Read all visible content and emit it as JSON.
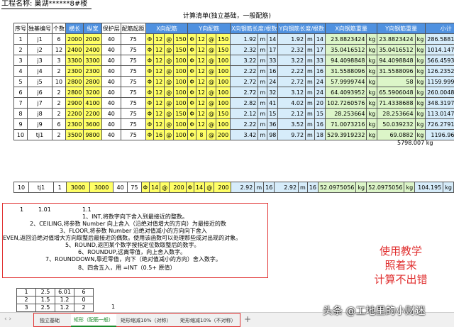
{
  "project_title": "工程名称: 巢湖******8#楼",
  "calc_title": "计算清单(独立基础，一般配筋)",
  "headers": [
    "序号",
    "独基编号",
    "个数",
    "横长",
    "纵宽",
    "保护层",
    "配筋起距",
    "X向配筋",
    "Y向配筋",
    "X向钢筋长度/根数",
    "Y向钢筋长度/根数",
    "X向钢筋重量",
    "Y向钢筋重量",
    "小计"
  ],
  "rows": [
    {
      "no": "1",
      "id": "j1",
      "count": "6",
      "len": "2000",
      "wid": "2000",
      "cover": "40",
      "start": "75",
      "x_phi": "Φ",
      "x_d": "12",
      "x_at": "@",
      "x_s": "150",
      "y_phi": "Φ",
      "y_d": "12",
      "y_at": "@",
      "y_s": "150",
      "xl": "1.92",
      "xu": "m",
      "xn": "14",
      "yl": "1.92",
      "yu": "m",
      "yn": "14",
      "xw": "23.8823424",
      "xwu": "kg",
      "yw": "23.8823424",
      "ywu": "kg",
      "sub": "286.5881",
      "subu": "kg"
    },
    {
      "no": "2",
      "id": "j2",
      "count": "12",
      "len": "2400",
      "wid": "2400",
      "cover": "40",
      "start": "75",
      "x_phi": "Φ",
      "x_d": "12",
      "x_at": "@",
      "x_s": "150",
      "y_phi": "Φ",
      "y_d": "12",
      "y_at": "@",
      "y_s": "150",
      "xl": "2.32",
      "xu": "m",
      "xn": "17",
      "yl": "2.32",
      "yu": "m",
      "yn": "17",
      "xw": "35.0416512",
      "xwu": "kg",
      "yw": "35.0416512",
      "ywu": "kg",
      "sub": "1014.147",
      "subu": "kg"
    },
    {
      "no": "3",
      "id": "j3",
      "count": "3",
      "len": "3300",
      "wid": "3300",
      "cover": "40",
      "start": "75",
      "x_phi": "Φ",
      "x_d": "12",
      "x_at": "@",
      "x_s": "100",
      "y_phi": "Φ",
      "y_d": "12",
      "y_at": "@",
      "y_s": "100",
      "xl": "3.22",
      "xu": "m",
      "xn": "33",
      "yl": "3.22",
      "yu": "m",
      "yn": "33",
      "xw": "94.4098848",
      "xwu": "kg",
      "yw": "94.4098848",
      "ywu": "kg",
      "sub": "566.4593",
      "subu": "kg"
    },
    {
      "no": "4",
      "id": "j4",
      "count": "2",
      "len": "2300",
      "wid": "2300",
      "cover": "40",
      "start": "75",
      "x_phi": "Φ",
      "x_d": "12",
      "x_at": "@",
      "x_s": "100",
      "y_phi": "Φ",
      "y_d": "12",
      "y_at": "@",
      "y_s": "100",
      "xl": "2.22",
      "xu": "m",
      "xn": "16",
      "yl": "2.22",
      "yu": "m",
      "yn": "16",
      "xw": "31.5588096",
      "xwu": "kg",
      "yw": "31.5588096",
      "ywu": "kg",
      "sub": "126.2352",
      "subu": "kg"
    },
    {
      "no": "5",
      "id": "j5",
      "count": "10",
      "len": "2800",
      "wid": "2800",
      "cover": "40",
      "start": "75",
      "x_phi": "Φ",
      "x_d": "12",
      "x_at": "@",
      "x_s": "100",
      "y_phi": "Φ",
      "y_d": "12",
      "y_at": "@",
      "y_s": "100",
      "xl": "2.72",
      "xu": "m",
      "xn": "24",
      "yl": "2.72",
      "yu": "m",
      "yn": "24",
      "xw": "57.9999744",
      "xwu": "kg",
      "yw": "58",
      "ywu": "kg",
      "sub": "1159.999",
      "subu": "kg"
    },
    {
      "no": "6",
      "id": "j6",
      "count": "2",
      "len": "2800",
      "wid": "3200",
      "cover": "40",
      "start": "75",
      "x_phi": "Φ",
      "x_d": "12",
      "x_at": "@",
      "x_s": "100",
      "y_phi": "Φ",
      "y_d": "12",
      "y_at": "@",
      "y_s": "100",
      "xl": "2.72",
      "xu": "m",
      "xn": "32",
      "yl": "3.12",
      "yu": "m",
      "yn": "24",
      "xw": "64.4093952",
      "xwu": "kg",
      "yw": "65.5906048",
      "ywu": "kg",
      "sub": "260.0048",
      "subu": "kg"
    },
    {
      "no": "7",
      "id": "j7",
      "count": "2",
      "len": "2900",
      "wid": "4100",
      "cover": "40",
      "start": "75",
      "x_phi": "Φ",
      "x_d": "12",
      "x_at": "@",
      "x_s": "100",
      "y_phi": "Φ",
      "y_d": "12",
      "y_at": "@",
      "y_s": "100",
      "xl": "2.82",
      "xu": "m",
      "xn": "41",
      "yl": "4.02",
      "yu": "m",
      "yn": "20",
      "xw": "102.7260576",
      "xwu": "kg",
      "yw": "71.4338688",
      "ywu": "kg",
      "sub": "348.3197",
      "subu": "kg"
    },
    {
      "no": "8",
      "id": "j8",
      "count": "2",
      "len": "2200",
      "wid": "2200",
      "cover": "40",
      "start": "75",
      "x_phi": "Φ",
      "x_d": "12",
      "x_at": "@",
      "x_s": "150",
      "y_phi": "Φ",
      "y_d": "12",
      "y_at": "@",
      "y_s": "150",
      "xl": "2.12",
      "xu": "m",
      "xn": "15",
      "yl": "2.12",
      "yu": "m",
      "yn": "15",
      "xw": "28.253664",
      "xwu": "kg",
      "yw": "28.253664",
      "ywu": "kg",
      "sub": "113.0147",
      "subu": "kg"
    },
    {
      "no": "9",
      "id": "j9",
      "count": "6",
      "len": "2300",
      "wid": "3600",
      "cover": "40",
      "start": "75",
      "x_phi": "Φ",
      "x_d": "12",
      "x_at": "@",
      "x_s": "100",
      "y_phi": "Φ",
      "y_d": "12",
      "y_at": "@",
      "y_s": "100",
      "xl": "2.22",
      "xu": "m",
      "xn": "36",
      "yl": "3.52",
      "yu": "m",
      "yn": "16",
      "xw": "71.0073216",
      "xwu": "kg",
      "yw": "50.039232",
      "ywu": "kg",
      "sub": "726.2791",
      "subu": "kg"
    },
    {
      "no": "10",
      "id": "tj1",
      "count": "2",
      "len": "3500",
      "wid": "9800",
      "cover": "40",
      "start": "75",
      "x_phi": "Φ",
      "x_d": "16",
      "x_at": "@",
      "x_s": "100",
      "y_phi": "Φ",
      "y_d": "8",
      "y_at": "@",
      "y_s": "200",
      "xl": "3.42",
      "xu": "m",
      "xn": "98",
      "yl": "9.72",
      "yu": "m",
      "yn": "18",
      "xw": "529.3919232",
      "xwu": "kg",
      "yw": "69.0882",
      "ywu": "kg",
      "sub": "1196.96",
      "subu": "kg"
    }
  ],
  "total": "5798.007 kg",
  "extra_row": {
    "no": "10",
    "id": "tj1",
    "count": "1",
    "len": "3000",
    "wid": "3000",
    "cover": "40",
    "start": "75",
    "x_phi": "Φ",
    "x_d": "14",
    "x_at": "@",
    "x_s": "200",
    "y_phi": "Φ",
    "y_d": "14",
    "y_at": "@",
    "y_s": "200",
    "xl": "2.92",
    "xu": "m",
    "xn": "16",
    "yl": "2.92",
    "yu": "m",
    "yn": "16",
    "xw": "52.0975056",
    "xwu": "kg",
    "yw": "52.0975056",
    "ywu": "kg",
    "sub": "104.195",
    "subu": "kg"
  },
  "notes": {
    "n1": "1",
    "n2": "1.01",
    "n3": "1.1",
    "lines": [
      "1、INT,将数字向下舍入到最接近的整数。",
      "2、CEILING,将参数 Number 向上舍入（沿绝对值增大的方向）为最接近的数",
      "3、FLOOR,将参数 Number 沿绝对值减小的方向向下舍入",
      "EVEN,返回沿绝对值增大方向取整后最接近的偶数。使用该函数可以处理那些成对出现的对象。",
      "5、ROUND,返回某个数字按指定位数取整后的数字。",
      "6、ROUNDUP,远离零值，向上舍入数字。",
      "7、ROUNDDOWN,靠近零值，向下（绝对值减小的方向）舍入数字。",
      "8、四舍五入，用 =INT（0.5+ 原值）"
    ]
  },
  "callout": [
    "使用教学",
    "照着来",
    "计算不出错"
  ],
  "small_table": [
    [
      "1",
      "2.5",
      "6.01",
      "6"
    ],
    [
      "2",
      "1.5",
      "1.2",
      "0"
    ],
    [
      "3",
      "2.5",
      "1.2",
      "2"
    ],
    [
      "4",
      "",
      "",
      ""
    ]
  ],
  "stray_value": "1",
  "tabs": {
    "prev_arrows": "‹ ›",
    "items": [
      "独立基础",
      "矩形（配筋一般）",
      "矩形缩减10%（对称）",
      "矩形缩减10%（不对称）"
    ],
    "active_index": 1,
    "add": "+"
  },
  "watermark": "头条 @工地里的小财迷"
}
